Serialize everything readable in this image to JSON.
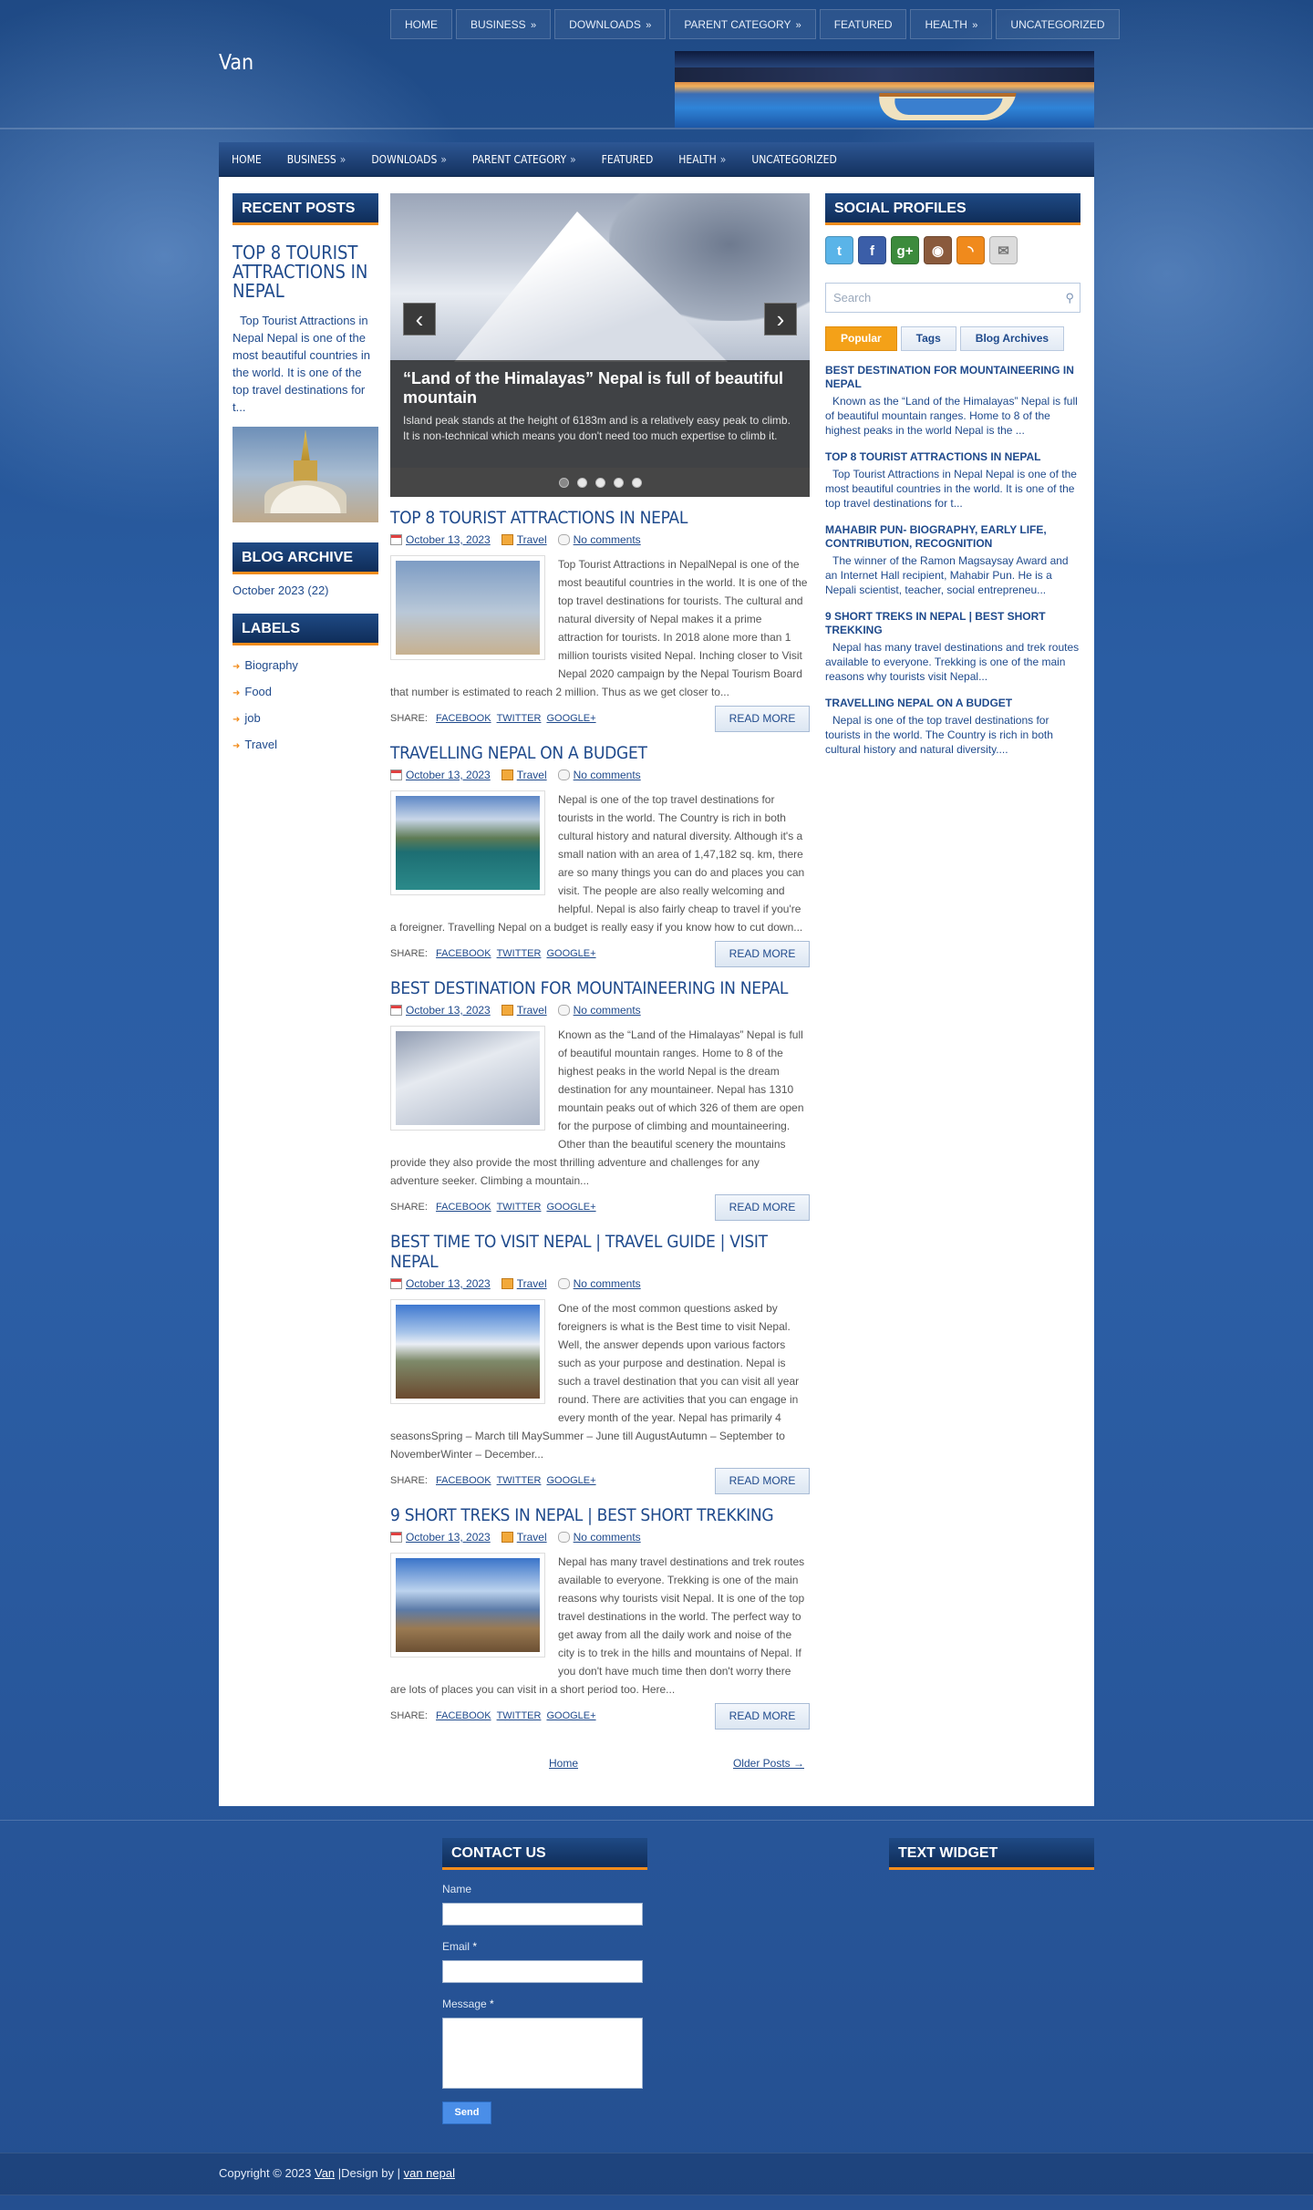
{
  "site": {
    "title": "Van"
  },
  "top_nav": [
    {
      "label": "HOME",
      "arrow": ""
    },
    {
      "label": "BUSINESS",
      "arrow": "»"
    },
    {
      "label": "DOWNLOADS",
      "arrow": "»"
    },
    {
      "label": "PARENT CATEGORY",
      "arrow": "»"
    },
    {
      "label": "FEATURED",
      "arrow": ""
    },
    {
      "label": "HEALTH",
      "arrow": "»"
    },
    {
      "label": "UNCATEGORIZED",
      "arrow": ""
    }
  ],
  "main_nav": [
    {
      "label": "HOME",
      "arrow": ""
    },
    {
      "label": "BUSINESS",
      "arrow": "»"
    },
    {
      "label": "DOWNLOADS",
      "arrow": "»"
    },
    {
      "label": "PARENT CATEGORY",
      "arrow": "»"
    },
    {
      "label": "FEATURED",
      "arrow": ""
    },
    {
      "label": "HEALTH",
      "arrow": "»"
    },
    {
      "label": "UNCATEGORIZED",
      "arrow": ""
    }
  ],
  "left": {
    "recent_posts_title": "RECENT POSTS",
    "recent_post_title": "TOP 8 TOURIST ATTRACTIONS IN NEPAL",
    "recent_post_excerpt": "Top Tourist Attractions in Nepal Nepal is one of the most beautiful countries in the world. It is one of the top travel destinations for t...",
    "archive_title": "BLOG ARCHIVE",
    "archive_item": "October 2023 (22)",
    "labels_title": "LABELS",
    "labels": [
      "Biography",
      "Food",
      "job",
      "Travel"
    ]
  },
  "slider": {
    "prev": "‹",
    "next": "›",
    "caption_title": "“Land of the Himalayas” Nepal is full of beautiful mountain",
    "caption_text": "Island peak stands at the height of 6183m and is a relatively easy peak to climb. It is non-technical which means you don't need too much expertise to climb it.",
    "dots": 5,
    "active_dot": 0
  },
  "posts": [
    {
      "title": "TOP 8 TOURIST ATTRACTIONS IN NEPAL",
      "date": "October 13, 2023",
      "label": "Travel",
      "comments": "No comments",
      "excerpt": "Top Tourist Attractions in NepalNepal is one of the most beautiful countries in the world. It is one of the top travel destinations for tourists. The cultural and natural diversity of Nepal makes it a prime attraction for tourists. In 2018 alone more than 1 million tourists visited Nepal. Inching closer to Visit Nepal 2020 campaign by the Nepal Tourism Board that number is estimated to reach 2 million. Thus as we get closer to...",
      "thumb": "t-stupa"
    },
    {
      "title": "TRAVELLING NEPAL ON A BUDGET",
      "date": "October 13, 2023",
      "label": "Travel",
      "comments": "No comments",
      "excerpt": "Nepal is one of the top travel destinations for tourists in the world. The Country is rich in both cultural history and natural diversity. Although it's a small nation with an area of 1,47,182 sq. km, there are so many things you can do and places you can visit. The people are also really welcoming and helpful. Nepal is also fairly cheap to travel if you're a foreigner. Travelling Nepal on a budget is really easy if you know how to cut down...",
      "thumb": "t-lake"
    },
    {
      "title": "BEST DESTINATION FOR MOUNTAINEERING IN NEPAL",
      "date": "October 13, 2023",
      "label": "Travel",
      "comments": "No comments",
      "excerpt": "Known as the “Land of the Himalayas” Nepal is full of beautiful mountain ranges. Home to 8 of the highest peaks in the world Nepal is the dream destination for any mountaineer. Nepal has 1310 mountain peaks out of which 326 of them are open for the purpose of climbing and mountaineering. Other than the beautiful scenery the mountains provide they also provide the most thrilling adventure and challenges for any adventure seeker. Climbing a mountain...",
      "thumb": "t-mount"
    },
    {
      "title": "BEST TIME TO VISIT NEPAL | TRAVEL GUIDE | VISIT NEPAL",
      "date": "October 13, 2023",
      "label": "Travel",
      "comments": "No comments",
      "excerpt": "One of the most common questions asked by foreigners is what is the Best time to visit Nepal. Well, the answer depends upon various factors such as your purpose and destination. Nepal is such a travel destination that you can visit all year round. There are activities that you can engage in every month of the year. Nepal has primarily 4 seasonsSpring – March till MaySummer – June till AugustAutumn – September to NovemberWinter – December...",
      "thumb": "t-valley"
    },
    {
      "title": "9 SHORT TREKS IN NEPAL | BEST SHORT TREKKING",
      "date": "October 13, 2023",
      "label": "Travel",
      "comments": "No comments",
      "excerpt": "Nepal has many travel destinations and trek routes available to everyone. Trekking is one of the main reasons why tourists visit Nepal. It is one of the top travel destinations in the world. The perfect way to get away from all the daily work and noise of the city is to trek in the hills and mountains of Nepal. If you don't have much time then don't worry there are lots of places you can visit in a short period too. Here...",
      "thumb": "t-trek"
    }
  ],
  "share": {
    "label": "SHARE:",
    "facebook": "FACEBOOK",
    "twitter": "TWITTER",
    "google": "GOOGLE+",
    "read_more": "READ MORE"
  },
  "pager": {
    "home": "Home",
    "older": "Older Posts →"
  },
  "right": {
    "social_title": "SOCIAL PROFILES",
    "socials": [
      {
        "icon": "twitter-icon",
        "glyph": "t",
        "color": "#5ab4e8"
      },
      {
        "icon": "facebook-icon",
        "glyph": "f",
        "color": "#3b5ea8"
      },
      {
        "icon": "googleplus-icon",
        "glyph": "g+",
        "color": "#3c8b3c"
      },
      {
        "icon": "instagram-icon",
        "glyph": "◉",
        "color": "#8a5a3c"
      },
      {
        "icon": "rss-icon",
        "glyph": "◝",
        "color": "#f08a1c"
      },
      {
        "icon": "email-icon",
        "glyph": "✉",
        "color": "#dcdcdc"
      }
    ],
    "search_placeholder": "Search",
    "tabs": [
      "Popular",
      "Tags",
      "Blog Archives"
    ],
    "popular": [
      {
        "title": "BEST DESTINATION FOR MOUNTAINEERING IN NEPAL",
        "text": "Known as the “Land of the Himalayas” Nepal is full of beautiful mountain ranges. Home to 8 of the highest peaks in the world Nepal is the ..."
      },
      {
        "title": "TOP 8 TOURIST ATTRACTIONS IN NEPAL",
        "text": "Top Tourist Attractions in Nepal Nepal is one of the most beautiful countries in the world. It is one of the top travel destinations for t..."
      },
      {
        "title": "MAHABIR PUN- BIOGRAPHY, EARLY LIFE, CONTRIBUTION, RECOGNITION",
        "text": "The winner of the Ramon Magsaysay Award and an Internet Hall recipient, Mahabir Pun. He is a Nepali scientist, teacher, social entrepreneu..."
      },
      {
        "title": "9 SHORT TREKS IN NEPAL | BEST SHORT TREKKING",
        "text": "Nepal has many  travel  destinations and trek routes available to everyone.  Trekking  is one of the main reasons why tourists visit Nepal..."
      },
      {
        "title": "TRAVELLING NEPAL ON A BUDGET",
        "text": "Nepal is one of the top travel destinations for tourists in the world. The Country is rich in both cultural history and natural diversity...."
      }
    ]
  },
  "footer": {
    "contact_title": "CONTACT US",
    "name_label": "Name",
    "email_label": "Email",
    "message_label": "Message",
    "required": "*",
    "send": "Send",
    "text_widget_title": "TEXT WIDGET",
    "copyright": "Copyright © 2023",
    "site_link": "Van",
    "design_by": "|Design by |",
    "designer": "van nepal"
  },
  "colors": {
    "accent": "#f28c1c",
    "link": "#1f4a8c",
    "background": "#24508f"
  }
}
